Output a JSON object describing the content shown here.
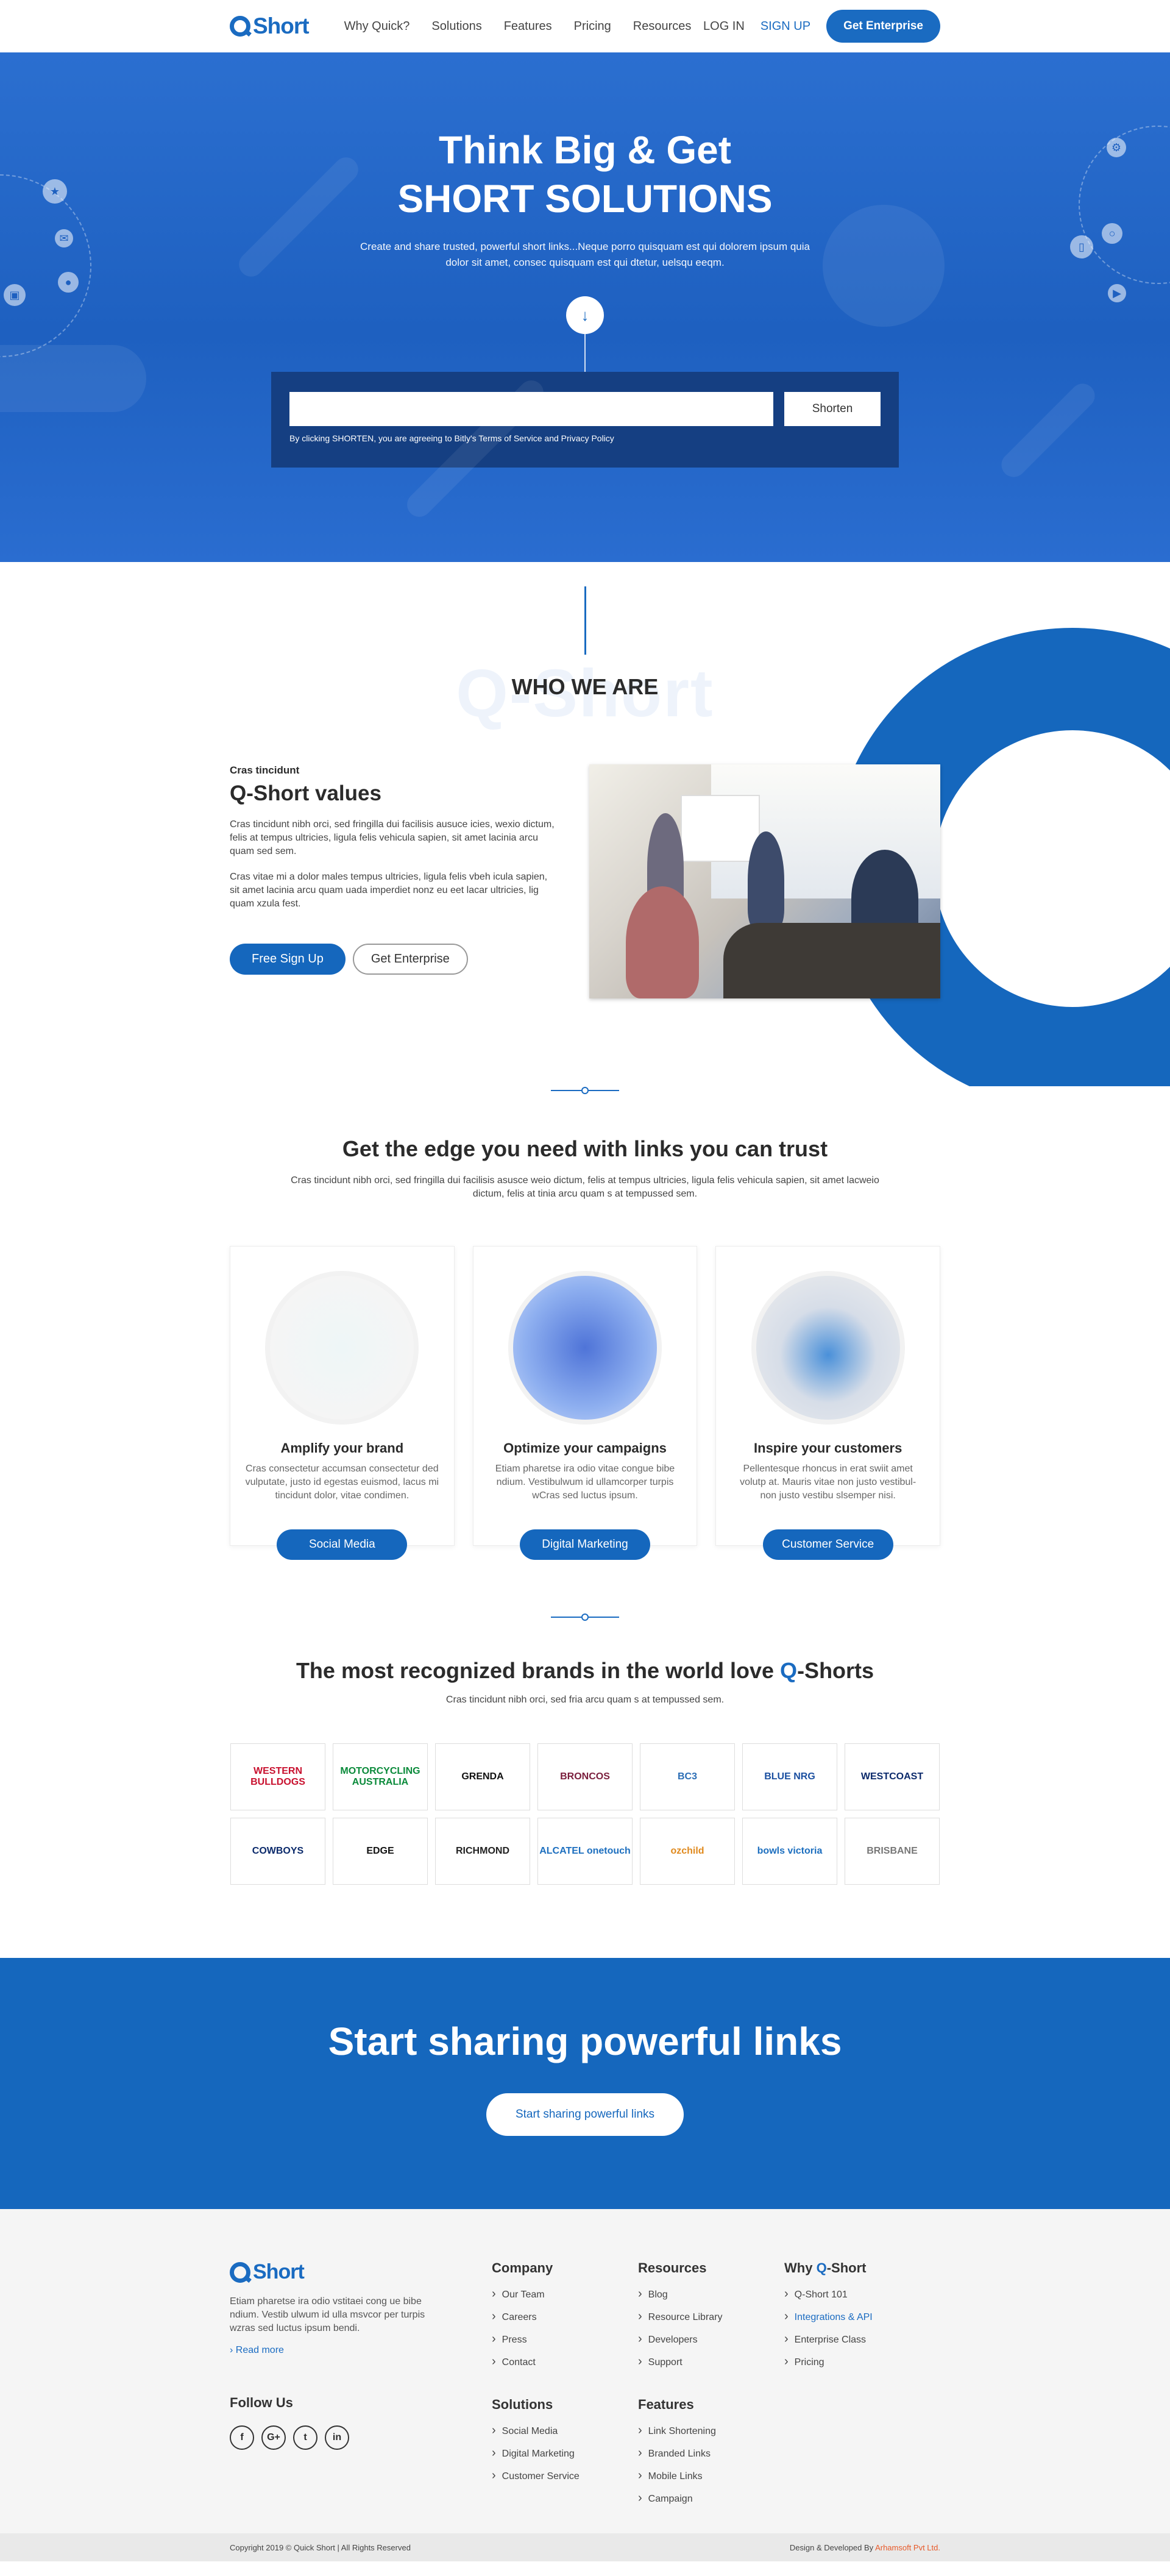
{
  "nav": {
    "logo": "Short",
    "menu": [
      "Why Quick?",
      "Solutions",
      "Features",
      "Pricing",
      "Resources"
    ],
    "login": "LOG IN",
    "signup": "SIGN UP",
    "enterprise": "Get Enterprise"
  },
  "hero": {
    "title_line1": "Think Big & Get",
    "title_line2": "SHORT SOLUTIONS",
    "description": "Create and share trusted, powerful short links...Neque porro quisquam est qui dolorem ipsum quia dolor sit amet, consec quisquam est qui dtetur, uelsqu eeqm.",
    "input_placeholder": "",
    "shorten_button": "Shorten",
    "terms_note": "By clicking SHORTEN, you are agreeing to Bitly's Terms of Service and Privacy Policy"
  },
  "who": {
    "ghost_text": "Q-Short",
    "title": "WHO WE ARE",
    "kicker": "Cras tincidunt",
    "heading": "Q-Short values",
    "para1": "Cras tincidunt nibh orci, sed fringilla dui facilisis ausuce icies, wexio dictum, felis at tempus ultricies, ligula felis vehicula sapien, sit amet lacinia arcu quam sed sem.",
    "para2": "Cras vitae mi a dolor males tempus ultricies, ligula felis vbeh icula sapien, sit amet lacinia arcu quam uada imperdiet nonz eu eet lacar ultricies, lig quam xzula fest.",
    "btn_signup": "Free Sign Up",
    "btn_enterprise": "Get Enterprise"
  },
  "edge": {
    "title": "Get the edge you need with links you can trust",
    "subtitle": "Cras tincidunt nibh orci, sed fringilla dui facilisis asusce weio dictum, felis at tempus ultricies, ligula felis vehicula sapien, sit amet lacweio dictum, felis at tinia arcu quam s at tempussed sem.",
    "cards": [
      {
        "title": "Amplify your brand",
        "text": "Cras consectetur accumsan consectetur ded vulputate, justo id egestas euismod, lacus mi tincidunt dolor, vitae condimen.",
        "button": "Social Media"
      },
      {
        "title": "Optimize your campaigns",
        "text": "Etiam pharetse ira odio vitae congue bibe ndium. Vestibulwum id ullamcorper turpis wCras sed luctus ipsum.",
        "button": "Digital Marketing"
      },
      {
        "title": "Inspire your customers",
        "text": "Pellentesque rhoncus in erat swiit amet volutp at. Mauris vitae non justo vestibul- non justo vestibu slsemper nisi.",
        "button": "Customer Service"
      }
    ]
  },
  "brands": {
    "title_pre": "The most recognized brands in the world love ",
    "title_q": "Q",
    "title_post": "-Shorts",
    "subtitle": "Cras tincidunt nibh orci, sed fria arcu quam s at tempussed sem.",
    "logos": [
      {
        "name": "WESTERN BULLDOGS",
        "color": "#c8102e"
      },
      {
        "name": "MOTORCYCLING AUSTRALIA",
        "color": "#0a8a3a"
      },
      {
        "name": "GRENDA",
        "color": "#111111"
      },
      {
        "name": "BRONCOS",
        "color": "#7a1e3c"
      },
      {
        "name": "BC3",
        "color": "#2a6db5"
      },
      {
        "name": "BLUE NRG",
        "color": "#1a4fa0"
      },
      {
        "name": "WESTCOAST",
        "color": "#0b2a6b"
      },
      {
        "name": "COWBOYS",
        "color": "#0b2a6b"
      },
      {
        "name": "EDGE",
        "color": "#111111"
      },
      {
        "name": "RICHMOND",
        "color": "#222222"
      },
      {
        "name": "ALCATEL onetouch",
        "color": "#1d6fbf"
      },
      {
        "name": "ozchild",
        "color": "#e08a1e"
      },
      {
        "name": "bowls victoria",
        "color": "#1d6fbf"
      },
      {
        "name": "BRISBANE",
        "color": "#777777"
      }
    ]
  },
  "cta": {
    "title": "Start sharing powerful links",
    "button": "Start sharing powerful links"
  },
  "footer": {
    "logo": "Short",
    "about": "Etiam pharetse ira odio vstitaei cong ue bibe ndium. Vestib ulwum id ulla msvcor per turpis wzras sed luctus ipsum bendi.",
    "read_more": "Read more",
    "follow_title": "Follow Us",
    "socials": [
      "f",
      "G+",
      "t",
      "in"
    ],
    "company": {
      "title": "Company",
      "items": [
        "Our Team",
        "Careers",
        "Press",
        "Contact"
      ]
    },
    "resources": {
      "title": "Resources",
      "items": [
        "Blog",
        "Resource Library",
        "Developers",
        "Support"
      ]
    },
    "why": {
      "title_pre": "Why ",
      "title_q": "Q",
      "title_post": "-Short",
      "items": [
        "Q-Short 101",
        "Integrations & API",
        "Enterprise Class",
        "Pricing"
      ]
    },
    "solutions": {
      "title": "Solutions",
      "items": [
        "Social Media",
        "Digital Marketing",
        "Customer Service"
      ]
    },
    "features": {
      "title": "Features",
      "items": [
        "Link Shortening",
        "Branded Links",
        "Mobile Links",
        "Campaign"
      ]
    },
    "copyright": "Copyright 2019 © Quick Short | All Rights Reserved",
    "credit_pre": "Design & Developed By ",
    "credit_name": "Arhamsoft Pvt Ltd."
  },
  "colors": {
    "primary": "#1567bd",
    "hero": "#1e60c0",
    "form": "#153f82",
    "credit": "#e75a2a"
  }
}
